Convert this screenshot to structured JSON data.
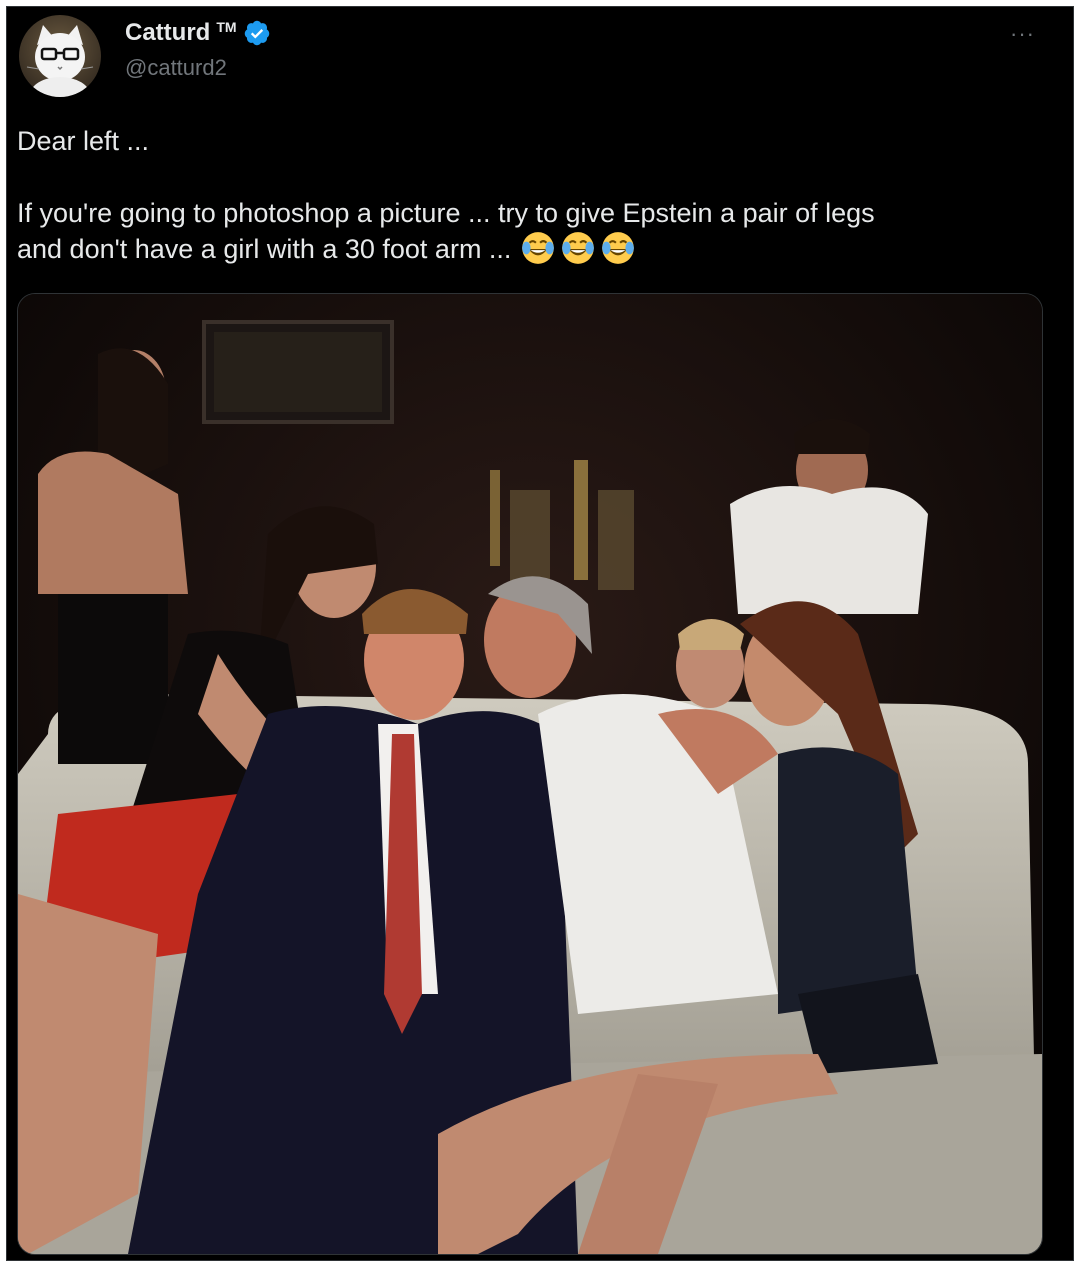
{
  "tweet": {
    "display_name": "Catturd",
    "trademark": "TM",
    "handle": "@catturd2",
    "more_label": "···",
    "verified_color": "#1d9bf0",
    "lines": [
      "Dear left ...",
      "If you're going to photoshop a picture ... try to give Epstein a pair of legs",
      "and don't have a girl with a 30 foot arm ..."
    ],
    "emoji": [
      "face-with-tears-of-joy",
      "face-with-tears-of-joy",
      "face-with-tears-of-joy"
    ]
  },
  "media": {
    "kind": "photo"
  },
  "colors": {
    "background": "#000000",
    "text": "#e7e9ea",
    "muted": "#71767b",
    "border": "#2f3336"
  }
}
